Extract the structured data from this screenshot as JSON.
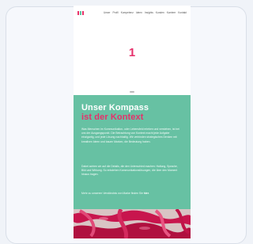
{
  "logo": {
    "alt": "logo"
  },
  "nav": {
    "items": [
      "Unser",
      "Profil",
      "Kompetenz",
      "Ideen",
      "Insights",
      "Kunden",
      "Karriere",
      "Kontakt"
    ]
  },
  "hero": {
    "number": "1"
  },
  "section": {
    "heading_line1": "Unser Kompass",
    "heading_line2": "ist der Kontext",
    "paragraph1": "Was Menschen im Kommunikation- oder Lebensfeld erleben und verstehen, ist bei uns der Ausgangspunkt. Die Betrachtung von Kontext macht jede Aufgabe einzigartig, und jede Lösung nachhaltig. Wir verbinden strategisches Denken mit kreativen Ideen und bauen Marken, die Bedeutung haben.",
    "paragraph2": "Dabei achten wir auf die Details, die den Unterschied machen: Haltung, Sprache, Bild und Wirkung. So entstehen Kommunikationslösungen, die über den Moment hinaus tragen.",
    "paragraph3_prefix": "Mehr zu unserem Verständnis von Marke finden Sie",
    "paragraph3_link": "hier",
    "paragraph3_suffix": "."
  },
  "colors": {
    "accent_pink": "#e6306b",
    "teal": "#67c1a3"
  }
}
